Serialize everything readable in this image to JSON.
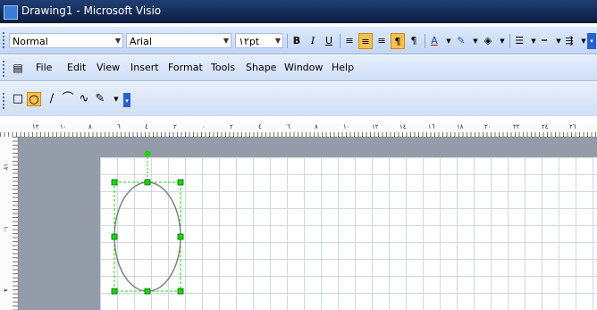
{
  "window": {
    "title": "Drawing1 - Microsoft Visio"
  },
  "format_toolbar": {
    "style_value": "Normal",
    "font_value": "Arial",
    "size_value": "١٢pt",
    "bold": "B",
    "italic": "I",
    "underline": "U",
    "font_color_letter": "A"
  },
  "menu": {
    "items": [
      "File",
      "Edit",
      "View",
      "Insert",
      "Format",
      "Tools",
      "Shape",
      "Window",
      "Help"
    ]
  },
  "ruler": {
    "h_labels": [
      "١٢",
      "١٠",
      "٨",
      "٦",
      "٤",
      "٢",
      "٠",
      "٢",
      "٤",
      "٦",
      "٨",
      "١٠",
      "١٢",
      "١٤",
      "١٦",
      "١٨",
      "٢٠",
      "٢٢",
      "٢٤",
      "٢٦"
    ],
    "v_labels": [
      "١٢",
      "١٠",
      "٨"
    ]
  },
  "colors": {
    "selection_handle": "#19d700",
    "rotation_handle": "#24d400",
    "highlight": "#f7c14f"
  }
}
